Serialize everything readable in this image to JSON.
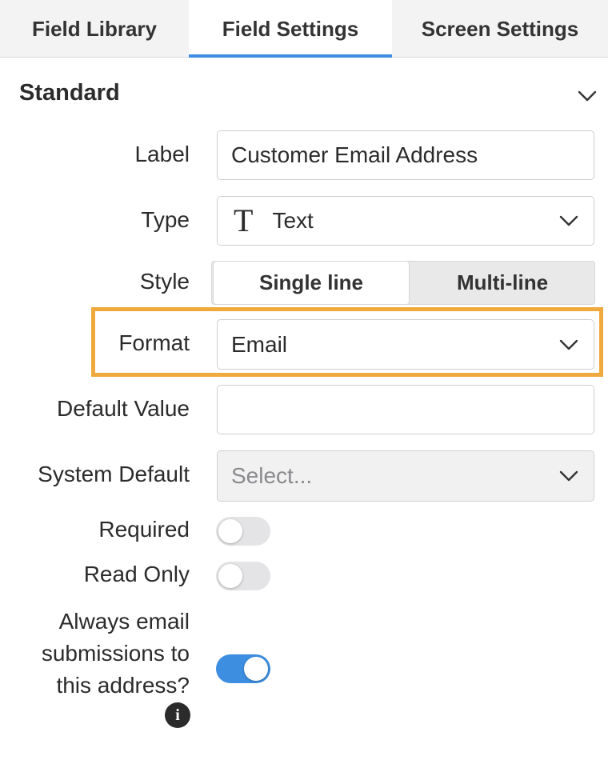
{
  "tabs": [
    {
      "label": "Field Library"
    },
    {
      "label": "Field Settings"
    },
    {
      "label": "Screen Settings"
    }
  ],
  "section": {
    "title": "Standard"
  },
  "fields": {
    "label": {
      "label": "Label",
      "value": "Customer Email Address"
    },
    "type": {
      "label": "Type",
      "value": "Text",
      "icon_glyph": "T"
    },
    "style": {
      "label": "Style",
      "options": [
        "Single line",
        "Multi-line"
      ],
      "selected": "Single line"
    },
    "format": {
      "label": "Format",
      "value": "Email"
    },
    "default_value": {
      "label": "Default Value",
      "value": ""
    },
    "system_default": {
      "label": "System Default",
      "placeholder": "Select..."
    },
    "required": {
      "label": "Required",
      "on": false
    },
    "read_only": {
      "label": "Read Only",
      "on": false
    },
    "always_email": {
      "label_lines": [
        "Always email",
        "submissions to",
        "this address?"
      ],
      "on": true,
      "info_glyph": "i"
    }
  },
  "colors": {
    "accent": "#3d8ee0",
    "highlight": "#f0a93c"
  }
}
